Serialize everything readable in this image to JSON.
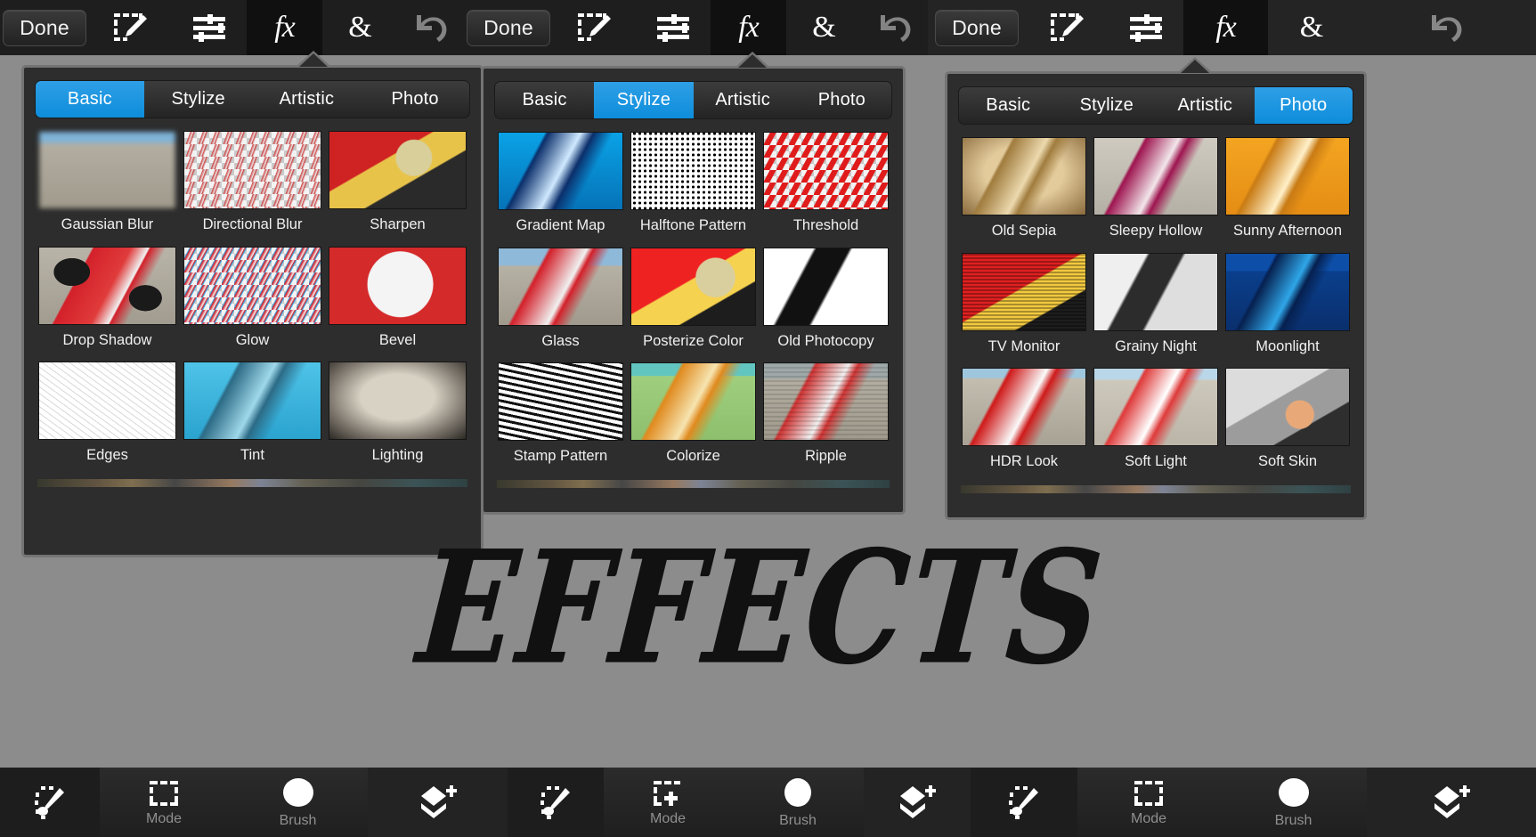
{
  "app": {
    "wordmark": "EFFECTS",
    "accent_color": "#0e8ddb",
    "panel_bg": "#2d2d2d",
    "page_bg": "#8c8c8c"
  },
  "toolbars": [
    {
      "done_label": "Done",
      "icons": [
        {
          "name": "selection-edit-icon",
          "glyph": "marquee-pencil"
        },
        {
          "name": "adjustments-icon",
          "glyph": "sliders"
        },
        {
          "name": "effects-fx-icon",
          "glyph": "fx",
          "active": true
        },
        {
          "name": "blend-ampersand-icon",
          "glyph": "&"
        },
        {
          "name": "undo-icon",
          "glyph": "undo",
          "dimmed": true
        }
      ]
    },
    {
      "done_label": "Done",
      "icons": [
        {
          "name": "selection-edit-icon",
          "glyph": "marquee-pencil"
        },
        {
          "name": "adjustments-icon",
          "glyph": "sliders"
        },
        {
          "name": "effects-fx-icon",
          "glyph": "fx",
          "active": true
        },
        {
          "name": "blend-ampersand-icon",
          "glyph": "&"
        },
        {
          "name": "undo-icon",
          "glyph": "undo",
          "dimmed": true
        }
      ]
    },
    {
      "done_label": "Done",
      "icons": [
        {
          "name": "selection-edit-icon",
          "glyph": "marquee-pencil"
        },
        {
          "name": "adjustments-icon",
          "glyph": "sliders"
        },
        {
          "name": "effects-fx-icon",
          "glyph": "fx",
          "active": true
        },
        {
          "name": "blend-ampersand-icon",
          "glyph": "&"
        },
        {
          "name": "undo-icon",
          "glyph": "undo",
          "dimmed": true
        }
      ]
    }
  ],
  "panels": [
    {
      "id": "panel-basic",
      "tabs": [
        "Basic",
        "Stylize",
        "Artistic",
        "Photo"
      ],
      "active_tab": "Basic",
      "active_tab_index": 0,
      "effects": [
        {
          "label": "Gaussian Blur",
          "thumb": "blurred-red-race-car-on-sand"
        },
        {
          "label": "Directional Blur",
          "thumb": "motion-blurred-red-race-car-on-transparent"
        },
        {
          "label": "Sharpen",
          "thumb": "sharpened-driver-closeup"
        },
        {
          "label": "Drop Shadow",
          "thumb": "red-race-car-with-drop-shadow-on-transparent"
        },
        {
          "label": "Glow",
          "thumb": "red-race-car-with-blue-glow-on-transparent"
        },
        {
          "label": "Bevel",
          "thumb": "beveled-number-three-closeup"
        },
        {
          "label": "Edges",
          "thumb": "pencil-edge-outline-of-race-car"
        },
        {
          "label": "Tint",
          "thumb": "cyan-tinted-race-car"
        },
        {
          "label": "Lighting",
          "thumb": "spotlight-lit-race-car"
        }
      ]
    },
    {
      "id": "panel-stylize",
      "tabs": [
        "Basic",
        "Stylize",
        "Artistic",
        "Photo"
      ],
      "active_tab": "Stylize",
      "active_tab_index": 1,
      "effects": [
        {
          "label": "Gradient Map",
          "thumb": "blue-gradient-mapped-race-car"
        },
        {
          "label": "Halftone Pattern",
          "thumb": "black-and-white-halftone-dots-race-car"
        },
        {
          "label": "Threshold",
          "thumb": "red-threshold-silhouette-on-transparent"
        },
        {
          "label": "Glass",
          "thumb": "glass-distorted-race-car"
        },
        {
          "label": "Posterize Color",
          "thumb": "posterized-driver-closeup"
        },
        {
          "label": "Old Photocopy",
          "thumb": "high-contrast-photocopy-race-car"
        },
        {
          "label": "Stamp Pattern",
          "thumb": "black-white-wavy-stamp-pattern"
        },
        {
          "label": "Colorize",
          "thumb": "green-orange-colorized-race-car"
        },
        {
          "label": "Ripple",
          "thumb": "rippled-race-car"
        }
      ]
    },
    {
      "id": "panel-photo",
      "tabs": [
        "Basic",
        "Stylize",
        "Artistic",
        "Photo"
      ],
      "active_tab": "Photo",
      "active_tab_index": 3,
      "effects": [
        {
          "label": "Old Sepia",
          "thumb": "sepia-toned-race-car"
        },
        {
          "label": "Sleepy Hollow",
          "thumb": "magenta-toned-race-car"
        },
        {
          "label": "Sunny Afternoon",
          "thumb": "warm-orange-race-car"
        },
        {
          "label": "TV Monitor",
          "thumb": "scanline-tv-monitor-driver"
        },
        {
          "label": "Grainy Night",
          "thumb": "grainy-black-and-white-race-car"
        },
        {
          "label": "Moonlight",
          "thumb": "deep-blue-moonlit-race-car"
        },
        {
          "label": "HDR Look",
          "thumb": "hdr-contrast-race-car"
        },
        {
          "label": "Soft Light",
          "thumb": "soft-light-race-car"
        },
        {
          "label": "Soft Skin",
          "thumb": "soft-skin-driver-portrait"
        }
      ]
    }
  ],
  "bottom_toolbars": [
    {
      "brush_icon": "selection-brush-icon",
      "mode": {
        "label": "Mode",
        "icon": "marquee-mode-icon"
      },
      "brush": {
        "label": "Brush",
        "icon": "brush-size-circle-icon"
      },
      "layers": {
        "icon": "add-layer-icon"
      }
    },
    {
      "brush_icon": "selection-brush-icon",
      "mode": {
        "label": "Mode",
        "icon": "marquee-add-mode-icon"
      },
      "brush": {
        "label": "Brush",
        "icon": "brush-size-circle-icon"
      },
      "layers": {
        "icon": "add-layer-icon"
      }
    },
    {
      "brush_icon": "selection-brush-icon",
      "mode": {
        "label": "Mode",
        "icon": "marquee-mode-icon"
      },
      "brush": {
        "label": "Brush",
        "icon": "brush-size-circle-icon"
      },
      "layers": {
        "icon": "add-layer-icon"
      }
    }
  ]
}
